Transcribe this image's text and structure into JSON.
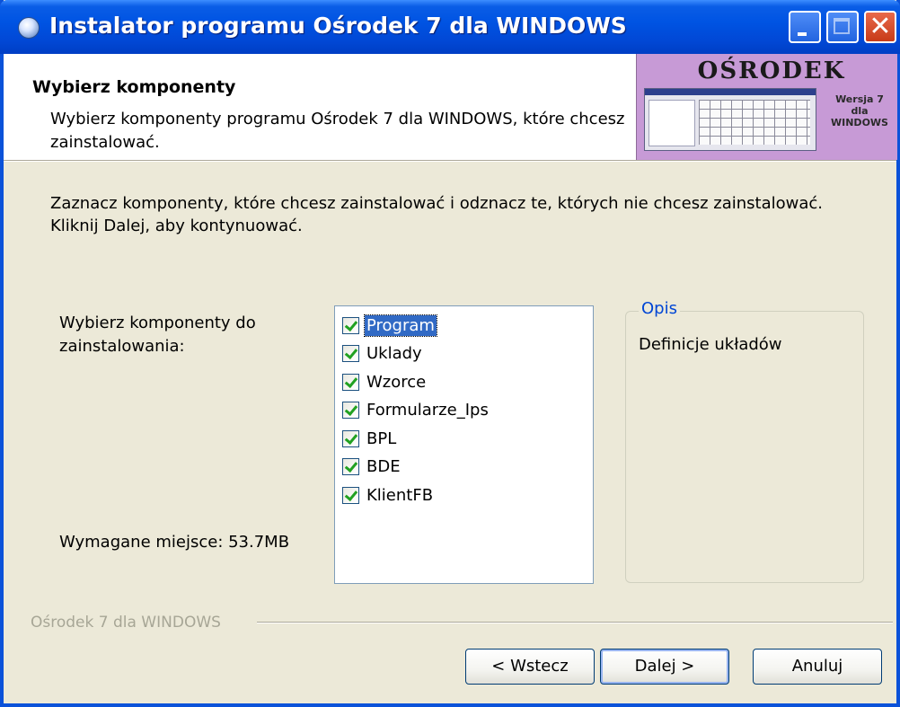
{
  "window": {
    "title": "Instalator programu Ośrodek 7 dla WINDOWS",
    "controls": [
      "minimize",
      "maximize",
      "close"
    ],
    "close_glyph": "✕"
  },
  "header": {
    "title": "Wybierz komponenty",
    "subtitle": "Wybierz komponenty programu Ośrodek 7 dla WINDOWS, które chcesz zainstalować.",
    "banner": {
      "title": "OŚRODEK",
      "version_line1": "Wersja 7",
      "version_line2": "dla",
      "version_line3": "WINDOWS"
    }
  },
  "main": {
    "intro": "Zaznacz komponenty, które chcesz zainstalować i odznacz te, których nie chcesz zainstalować. Kliknij Dalej, aby kontynuować.",
    "components_label": "Wybierz komponenty do zainstalowania:",
    "required_space": "Wymagane miejsce: 53.7MB",
    "components": [
      {
        "label": "Program",
        "checked": true,
        "selected": true
      },
      {
        "label": "Uklady",
        "checked": true,
        "selected": false
      },
      {
        "label": "Wzorce",
        "checked": true,
        "selected": false
      },
      {
        "label": "Formularze_Ips",
        "checked": true,
        "selected": false
      },
      {
        "label": "BPL",
        "checked": true,
        "selected": false
      },
      {
        "label": "BDE",
        "checked": true,
        "selected": false
      },
      {
        "label": "KlientFB",
        "checked": true,
        "selected": false
      }
    ],
    "description": {
      "legend": "Opis",
      "text": "Definicje układów"
    }
  },
  "footer": {
    "brand": "Ośrodek 7 dla WINDOWS",
    "back_label": "< Wstecz",
    "next_label": "Dalej >",
    "cancel_label": "Anuluj"
  },
  "colors": {
    "titlebar": "#0054e3",
    "window_bg": "#ece9d8",
    "banner_bg": "#c79ad6",
    "selection": "#316ac5",
    "legend_text": "#0046d5",
    "checkmark": "#21a121"
  }
}
